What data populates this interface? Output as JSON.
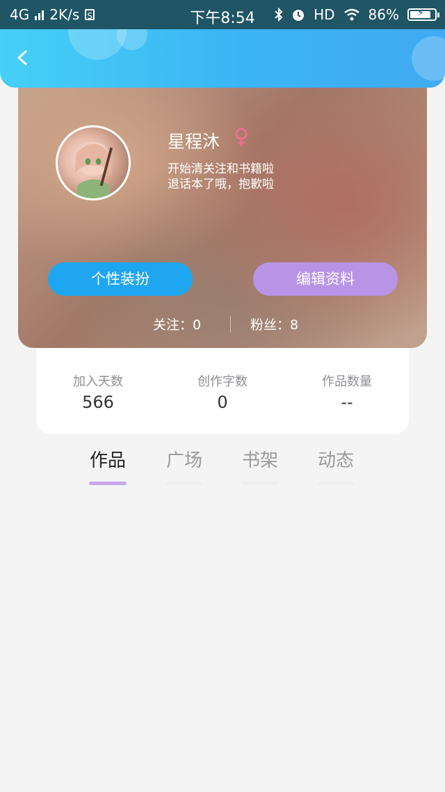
{
  "status_bar": {
    "network": "4G",
    "speed": "2K/s",
    "s_badge": "S",
    "time": "下午8:54",
    "hd": "HD",
    "battery": "86%",
    "battery_level": 0.86
  },
  "header": {
    "back_icon": "chevron-left-icon"
  },
  "profile": {
    "name": "星程沐",
    "gender_symbol": "♀",
    "bio_line1": "开始清关注和书籍啦",
    "bio_line2": "退话本了哦，抱歉啦",
    "decor_button": "个性装扮",
    "edit_button": "编辑资料",
    "following": "关注：0",
    "followers": "粉丝：8"
  },
  "stats": [
    {
      "label": "加入天数",
      "value": "566"
    },
    {
      "label": "创作字数",
      "value": "0"
    },
    {
      "label": "作品数量",
      "value": "--"
    }
  ],
  "tabs": [
    {
      "label": "作品",
      "active": true
    },
    {
      "label": "广场",
      "active": false
    },
    {
      "label": "书架",
      "active": false
    },
    {
      "label": "动态",
      "active": false
    }
  ],
  "colors": {
    "accent_blue": "#1fa6f1",
    "accent_purple": "#b994e6",
    "gender_pink": "#f06e94",
    "tab_indicator": "#c7a6ec"
  }
}
